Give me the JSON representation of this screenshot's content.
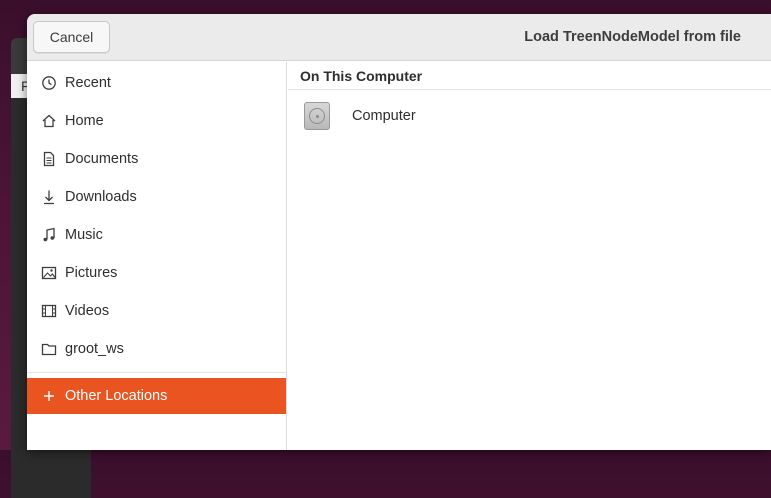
{
  "background_window": {
    "menu_char": "F"
  },
  "dialog": {
    "title": "Load TreenNodeModel from file",
    "cancel_label": "Cancel"
  },
  "sidebar": {
    "items": [
      {
        "label": "Recent",
        "icon": "clock-icon"
      },
      {
        "label": "Home",
        "icon": "home-icon"
      },
      {
        "label": "Documents",
        "icon": "document-icon"
      },
      {
        "label": "Downloads",
        "icon": "download-icon"
      },
      {
        "label": "Music",
        "icon": "music-icon"
      },
      {
        "label": "Pictures",
        "icon": "picture-icon"
      },
      {
        "label": "Videos",
        "icon": "video-icon"
      },
      {
        "label": "groot_ws",
        "icon": "folder-icon"
      }
    ],
    "other_locations": {
      "label": "Other Locations",
      "icon": "plus-icon",
      "selected": true
    }
  },
  "content": {
    "section_title": "On This Computer",
    "locations": [
      {
        "label": "Computer",
        "icon": "drive-icon"
      }
    ]
  },
  "colors": {
    "accent": "#e95420",
    "header_bg": "#ebebeb",
    "desktop_bg": "#4c1437"
  }
}
